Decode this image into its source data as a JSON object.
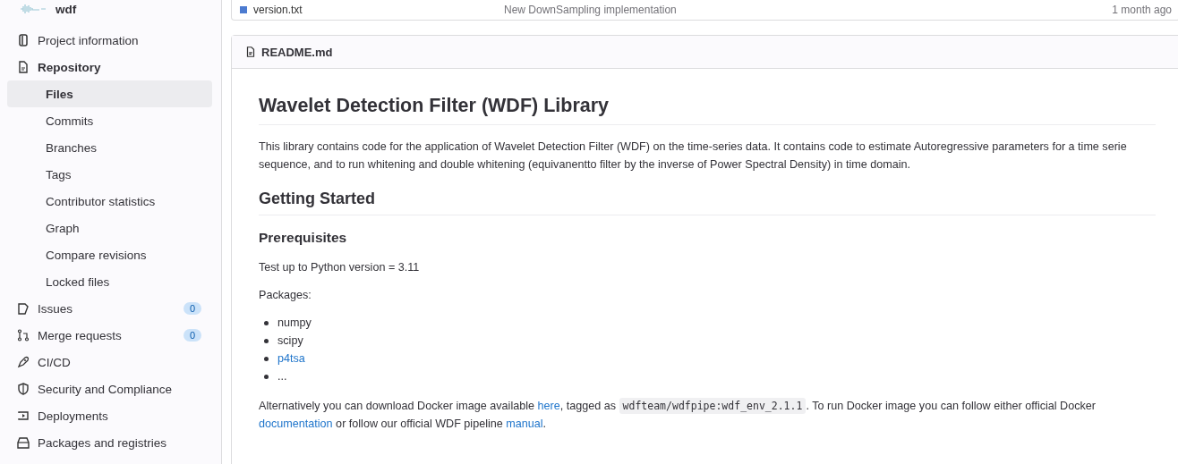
{
  "project": {
    "name": "wdf"
  },
  "sidebar": {
    "items": [
      {
        "label": "Project information",
        "kind": "section",
        "expanded": false,
        "selected": false
      },
      {
        "label": "Repository",
        "kind": "section",
        "expanded": true,
        "selected": false,
        "children": [
          {
            "label": "Files",
            "selected": true
          },
          {
            "label": "Commits",
            "selected": false
          },
          {
            "label": "Branches",
            "selected": false
          },
          {
            "label": "Tags",
            "selected": false
          },
          {
            "label": "Contributor statistics",
            "selected": false
          },
          {
            "label": "Graph",
            "selected": false
          },
          {
            "label": "Compare revisions",
            "selected": false
          },
          {
            "label": "Locked files",
            "selected": false
          }
        ]
      },
      {
        "label": "Issues",
        "kind": "section",
        "expanded": false,
        "selected": false,
        "badge": "0"
      },
      {
        "label": "Merge requests",
        "kind": "section",
        "expanded": false,
        "selected": false,
        "badge": "0"
      },
      {
        "label": "CI/CD",
        "kind": "section",
        "expanded": false,
        "selected": false
      },
      {
        "label": "Security and Compliance",
        "kind": "section",
        "expanded": false,
        "selected": false
      },
      {
        "label": "Deployments",
        "kind": "section",
        "expanded": false,
        "selected": false
      },
      {
        "label": "Packages and registries",
        "kind": "section",
        "expanded": false,
        "selected": false
      }
    ]
  },
  "files": {
    "rows": [
      {
        "name": "version.txt",
        "last_commit": "New DownSampling implementation",
        "last_update": "1 month ago"
      }
    ]
  },
  "readme": {
    "title": "README.md",
    "blocks": [
      {
        "kind": "h1",
        "text": "Wavelet Detection Filter (WDF) Library"
      },
      {
        "kind": "p",
        "parts": [
          {
            "kind": "text",
            "text": "This library contains code for the application of Wavelet Detection Filter (WDF) on the time-series data. It contains code to estimate Autoregressive parameters for a time serie sequence, and to run whitening and double whitening (equivanentto filter by the inverse of Power Spectral Density) in time domain."
          }
        ]
      },
      {
        "kind": "h2",
        "text": "Getting Started"
      },
      {
        "kind": "h3",
        "text": "Prerequisites"
      },
      {
        "kind": "p",
        "parts": [
          {
            "kind": "text",
            "text": "Test up to Python version = 3.11"
          }
        ]
      },
      {
        "kind": "p",
        "parts": [
          {
            "kind": "text",
            "text": "Packages:"
          }
        ]
      },
      {
        "kind": "list",
        "items": [
          {
            "kind": "text",
            "text": "numpy"
          },
          {
            "kind": "text",
            "text": "scipy"
          },
          {
            "kind": "link",
            "text": "p4tsa"
          },
          {
            "kind": "text",
            "text": "..."
          }
        ]
      },
      {
        "kind": "p",
        "parts": [
          {
            "kind": "text",
            "text": "Alternatively you can download Docker image available "
          },
          {
            "kind": "link",
            "text": "here"
          },
          {
            "kind": "text",
            "text": ", tagged as "
          },
          {
            "kind": "code",
            "text": "wdfteam/wdfpipe:wdf_env_2.1.1"
          },
          {
            "kind": "text",
            "text": ". To run Docker image you can follow either official Docker "
          },
          {
            "kind": "link",
            "text": "documentation"
          },
          {
            "kind": "text",
            "text": " or follow our official WDF pipeline "
          },
          {
            "kind": "link",
            "text": "manual"
          },
          {
            "kind": "text",
            "text": "."
          }
        ]
      }
    ]
  }
}
